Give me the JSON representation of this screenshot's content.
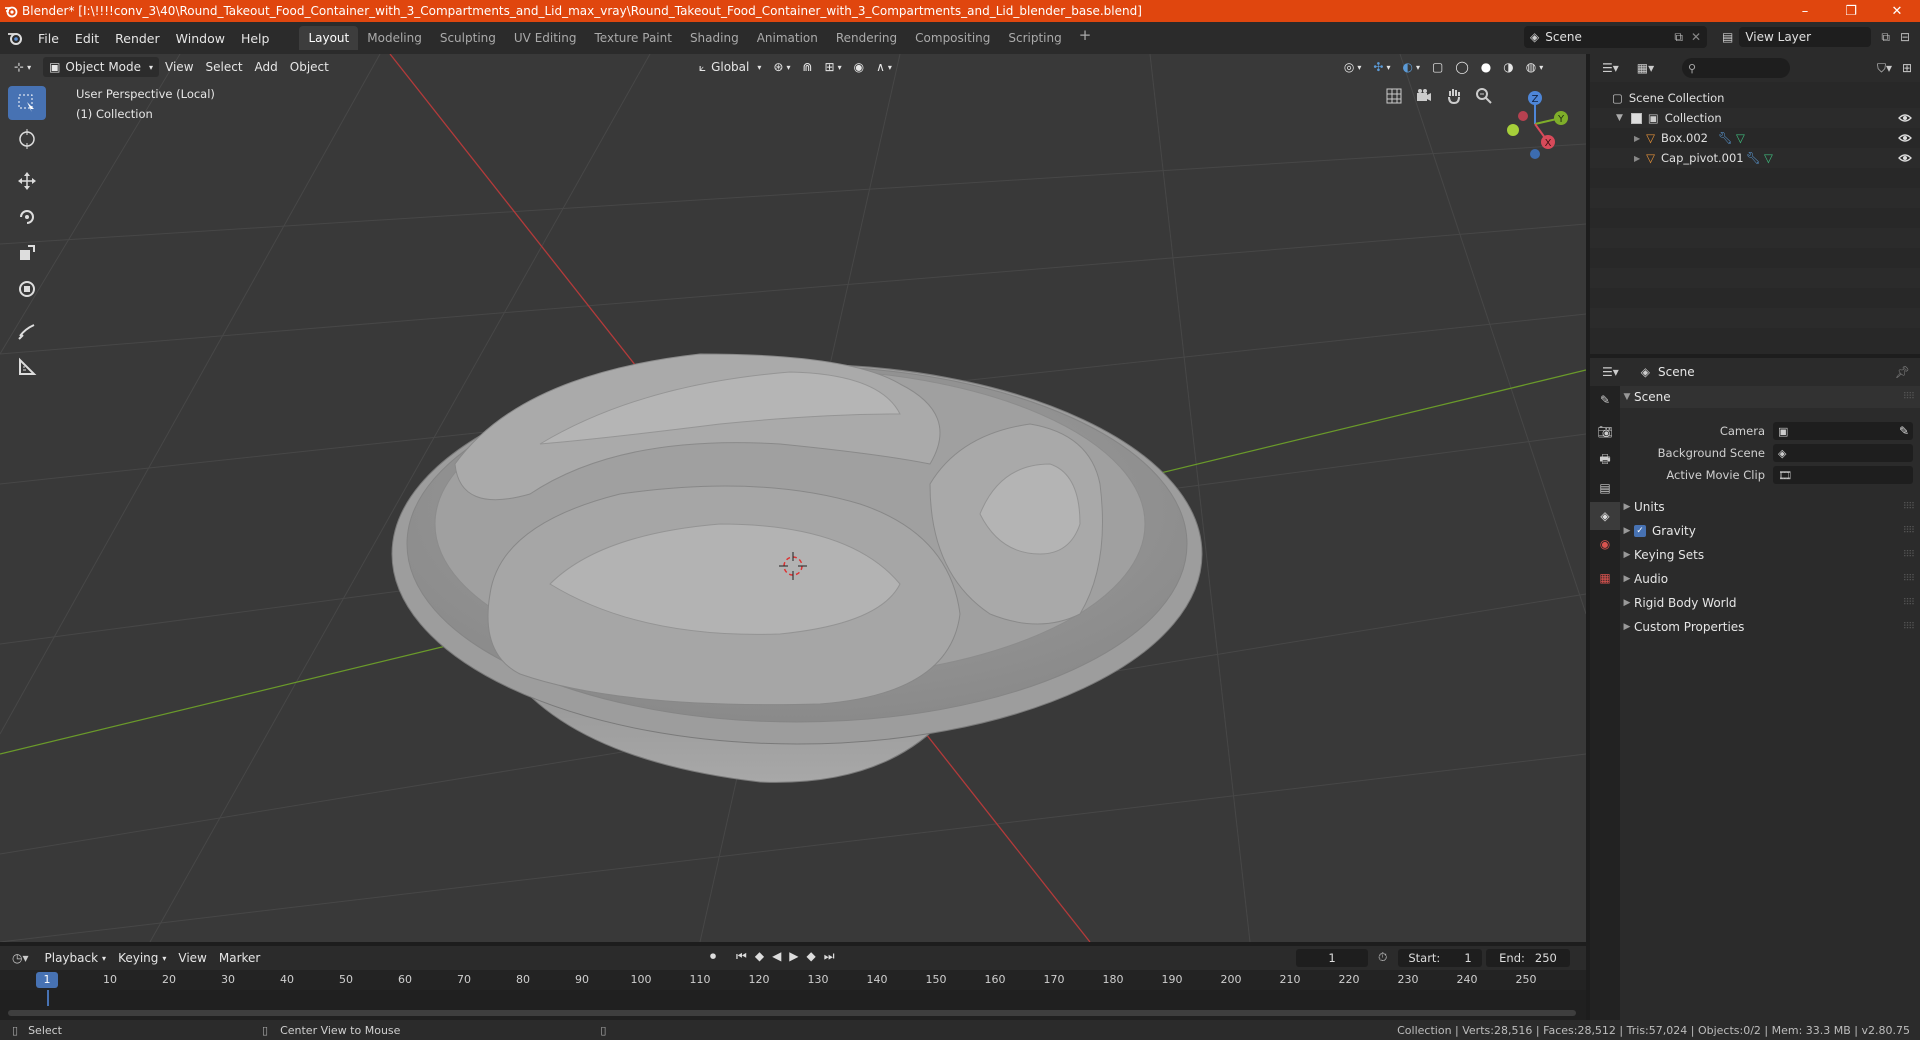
{
  "window": {
    "title": "Blender* [I:\\!!!!conv_3\\40\\Round_Takeout_Food_Container_with_3_Compartments_and_Lid_max_vray\\Round_Takeout_Food_Container_with_3_Compartments_and_Lid_blender_base.blend]",
    "controls": [
      "–",
      "❐",
      "✕"
    ]
  },
  "menu": {
    "items": [
      "File",
      "Edit",
      "Render",
      "Window",
      "Help"
    ],
    "workspaces": [
      "Layout",
      "Modeling",
      "Sculpting",
      "UV Editing",
      "Texture Paint",
      "Shading",
      "Animation",
      "Rendering",
      "Compositing",
      "Scripting"
    ],
    "active_workspace": "Layout",
    "add_tab": "+",
    "scene": "Scene",
    "view_layer": "View Layer"
  },
  "viewport": {
    "mode": "Object Mode",
    "menus": [
      "View",
      "Select",
      "Add",
      "Object"
    ],
    "transform_orientation": "Global",
    "info_line1": "User Perspective (Local)",
    "info_line2": "(1) Collection",
    "gizmo_axes": [
      "X",
      "Y",
      "Z"
    ],
    "colors": {
      "background": "#393939",
      "grid": "#474747",
      "x_axis": "#b33a3a",
      "y_axis": "#6a9a2a"
    },
    "tools": [
      "select-box",
      "cursor",
      "move",
      "rotate",
      "scale",
      "transform",
      "annotate",
      "measure"
    ],
    "nav_icons": [
      "grid-icon",
      "camera-icon",
      "hand-icon",
      "zoom-icon"
    ]
  },
  "outliner": {
    "root": "Scene Collection",
    "collection": "Collection",
    "objects": [
      {
        "name": "Box.002"
      },
      {
        "name": "Cap_pivot.001"
      }
    ]
  },
  "properties": {
    "header": "Scene",
    "panel": "Scene",
    "fields": [
      {
        "label": "Camera",
        "value": ""
      },
      {
        "label": "Background Scene",
        "value": ""
      },
      {
        "label": "Active Movie Clip",
        "value": ""
      }
    ],
    "sections": [
      "Units",
      "Gravity",
      "Keying Sets",
      "Audio",
      "Rigid Body World",
      "Custom Properties"
    ],
    "gravity_checked": true
  },
  "timeline": {
    "menus": [
      "Playback",
      "Keying",
      "View",
      "Marker"
    ],
    "current_frame": "1",
    "start_label": "Start:",
    "start": "1",
    "end_label": "End:",
    "end": "250",
    "ruler": [
      "1",
      "10",
      "20",
      "30",
      "40",
      "50",
      "60",
      "70",
      "80",
      "90",
      "100",
      "110",
      "120",
      "130",
      "140",
      "150",
      "160",
      "170",
      "180",
      "190",
      "200",
      "210",
      "220",
      "230",
      "240",
      "250"
    ]
  },
  "status": {
    "select": "Select",
    "center": "Center View to Mouse",
    "stats": "Collection | Verts:28,516 | Faces:28,512 | Tris:57,024 | Objects:0/2 | Mem: 33.3 MB | v2.80.75"
  }
}
